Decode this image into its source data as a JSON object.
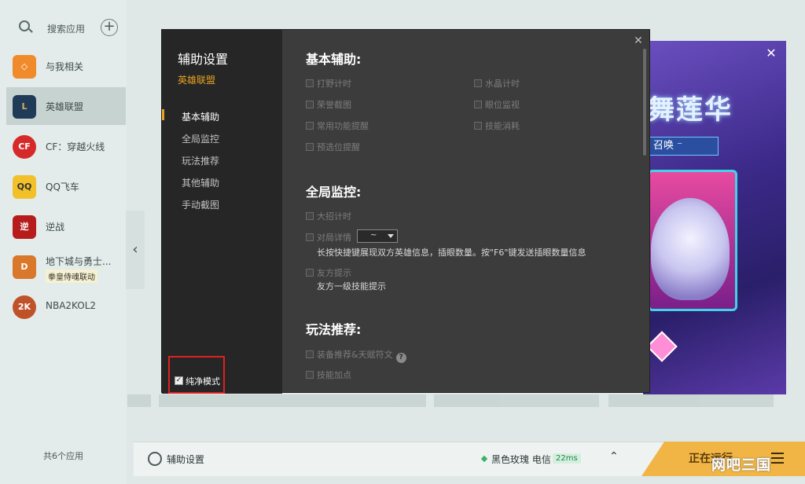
{
  "sidebar": {
    "search_label": "搜索应用",
    "add_icon": "plus-icon",
    "apps": [
      {
        "label": "与我相关",
        "icon": "related-icon",
        "color": "#f08a2a"
      },
      {
        "label": "英雄联盟",
        "icon": "lol-icon",
        "color": "#1f3b57"
      },
      {
        "label": "CF：穿越火线",
        "icon": "cf-icon",
        "color": "#d62a2a"
      },
      {
        "label": "QQ飞车",
        "icon": "qqspeed-icon",
        "color": "#f2c029"
      },
      {
        "label": "逆战",
        "icon": "nizhan-icon",
        "color": "#b71c1c"
      },
      {
        "label": "地下城与勇士...",
        "icon": "dnf-icon",
        "color": "#d9772b",
        "sub": "拳皇侍魂联动"
      },
      {
        "label": "NBA2KOL2",
        "icon": "nba2k-icon",
        "color": "#c0522a"
      }
    ],
    "count": "共6个应用"
  },
  "dialog": {
    "title": "辅助设置",
    "game": "英雄联盟",
    "nav": [
      "基本辅助",
      "全局监控",
      "玩法推荐",
      "其他辅助",
      "手动截图"
    ],
    "pure_mode": "纯净模式",
    "sections": {
      "basic": {
        "title": "基本辅助:",
        "left": [
          "打野计时",
          "荣誉截图",
          "常用功能提醒",
          "预选位提醒"
        ],
        "right": [
          "水晶计时",
          "眼位监视",
          "技能消耗"
        ]
      },
      "monitor": {
        "title": "全局监控:",
        "ult_timer": "大招计时",
        "detail": "对局详情",
        "detail_select": "~",
        "detail_desc": "长按快捷键展现双方英雄信息，插眼数量。按\"F6\"键发送插眼数量信息",
        "ally": "友方提示",
        "ally_desc": "友方一级技能提示"
      },
      "play": {
        "title": "玩法推荐:",
        "equip": "装备推荐&天赋符文",
        "skill": "技能加点"
      }
    }
  },
  "promo": {
    "title": "舞莲华",
    "subtitle": "召唤 ⁻",
    "close": "✕"
  },
  "statusbar": {
    "title": "辅助设置",
    "server": "黑色玫瑰 电信",
    "ping": "22ms",
    "running": "正在运行",
    "watermark": "网吧三国"
  }
}
